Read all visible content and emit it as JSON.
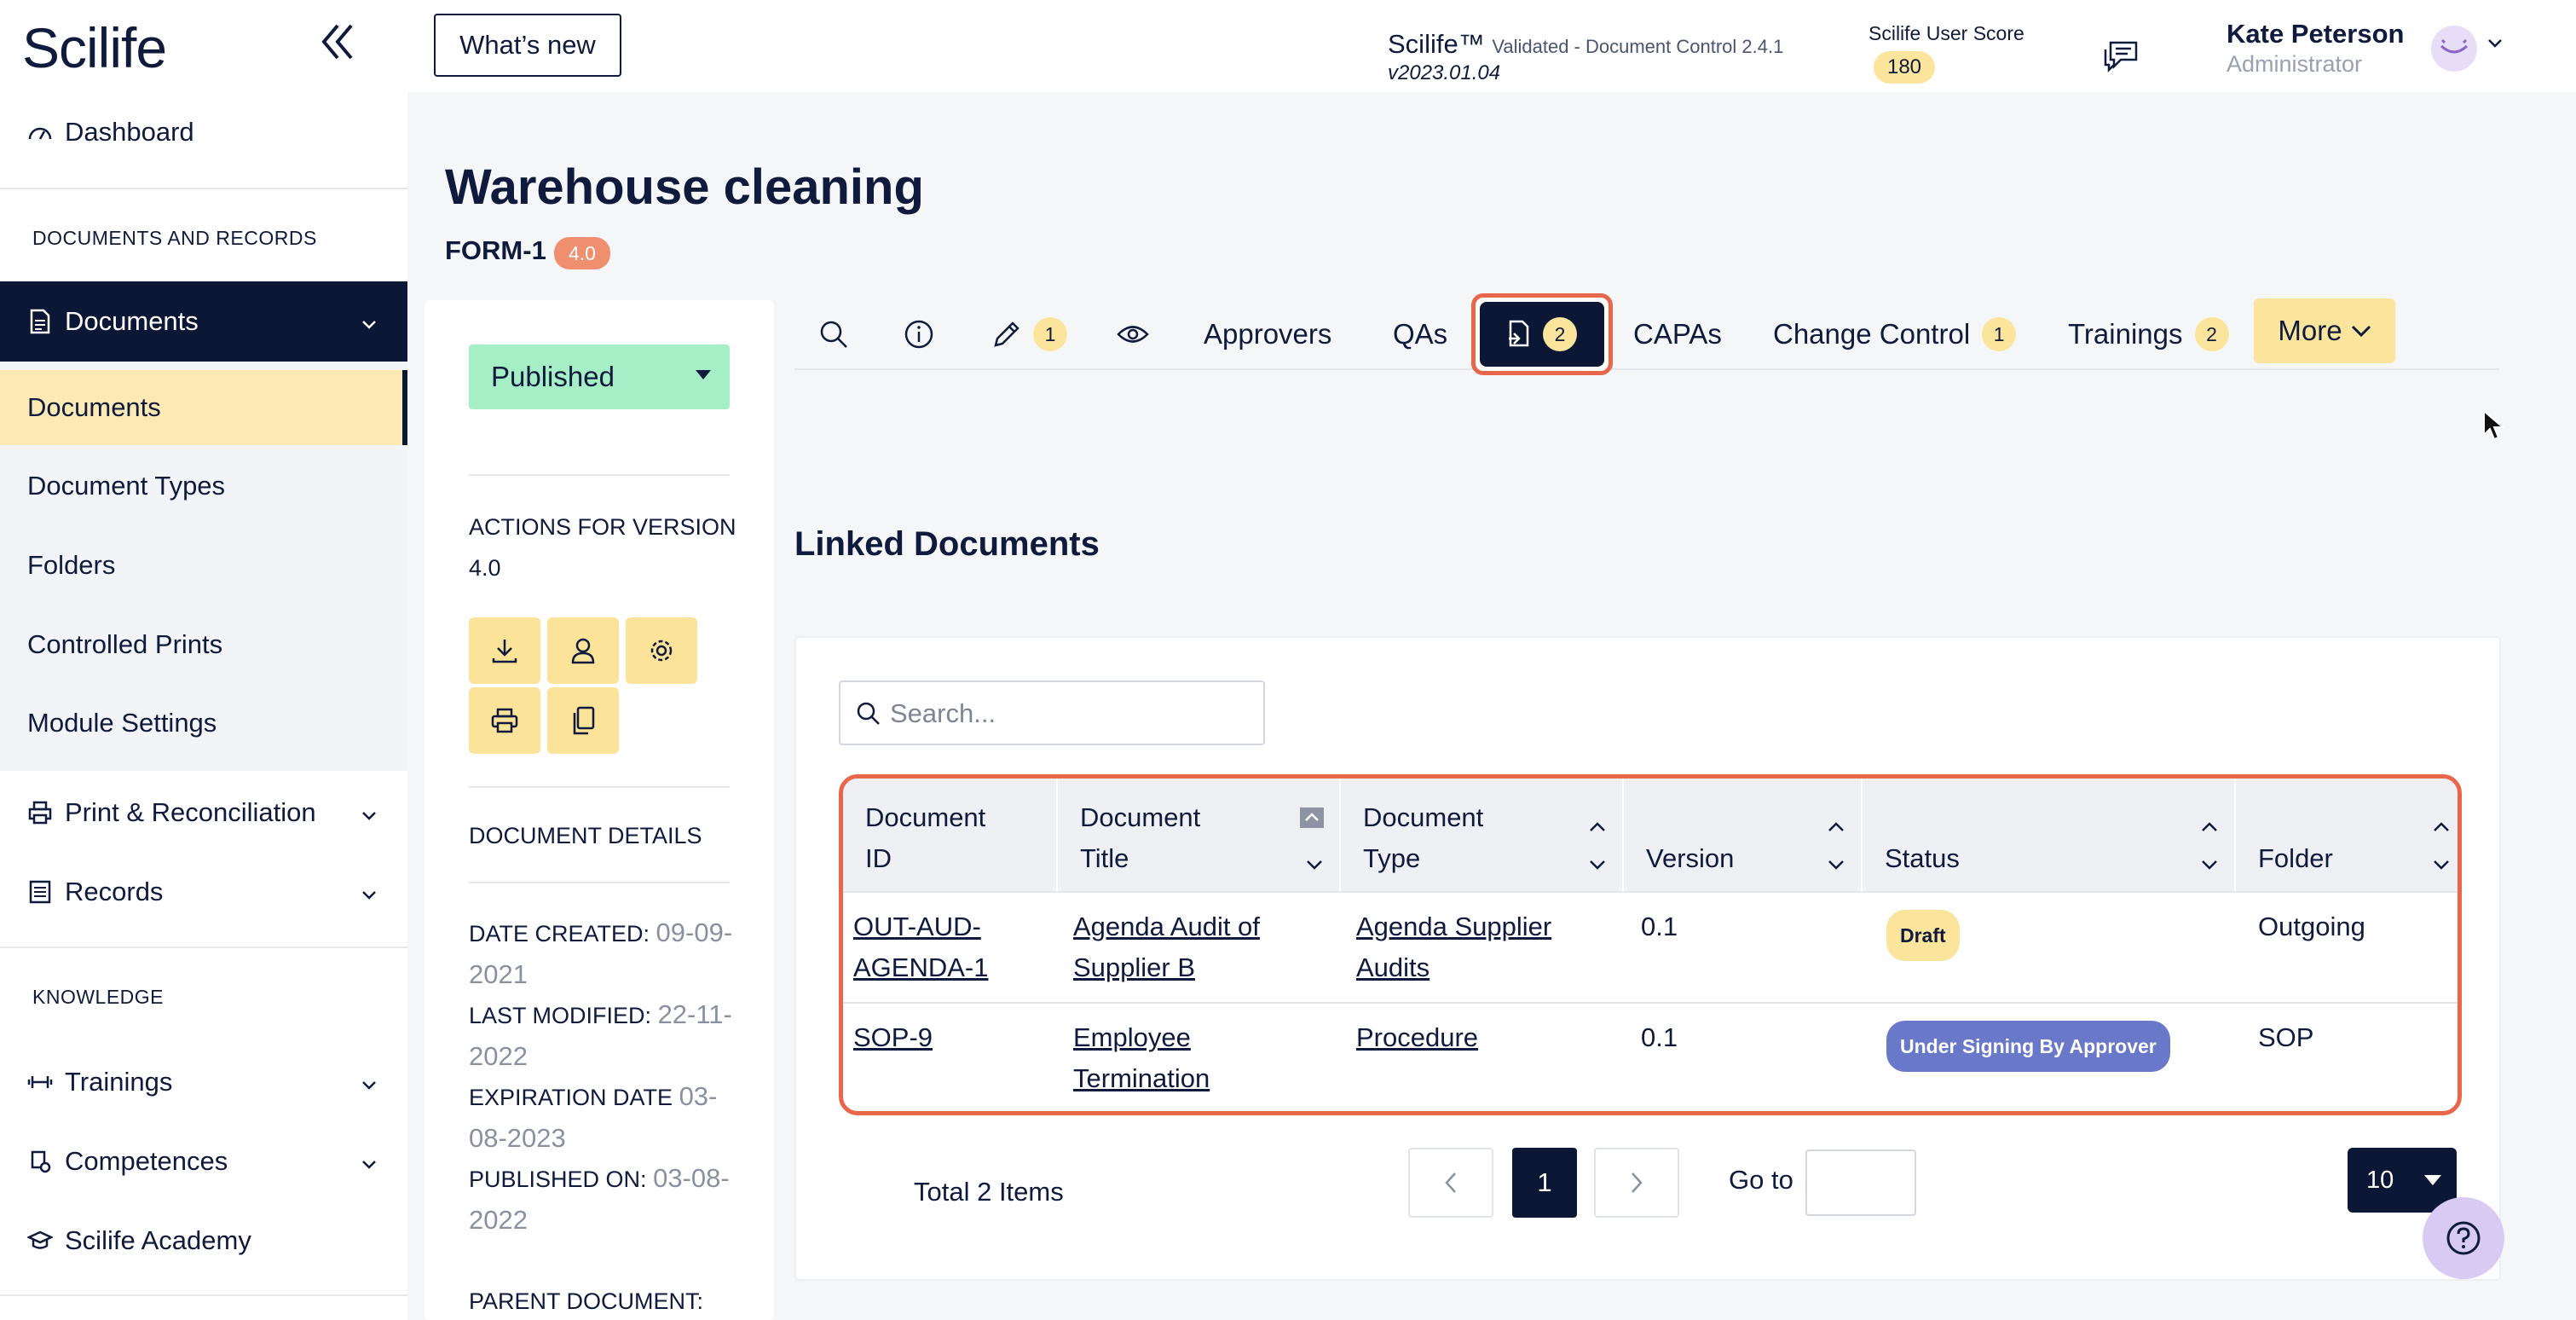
{
  "app": {
    "logo": "Scilife",
    "whats_new": "What’s new",
    "product_name": "Scilife™",
    "product_desc": "Validated - Document Control 2.4.1",
    "product_version": "v2023.01.04",
    "score_label": "Scilife User Score",
    "score_value": "180",
    "user_name": "Kate Peterson",
    "user_role": "Administrator"
  },
  "sidebar": {
    "dashboard": "Dashboard",
    "section_docs": "DOCUMENTS AND RECORDS",
    "documents": "Documents",
    "sub_items": [
      "Documents",
      "Document Types",
      "Folders",
      "Controlled Prints",
      "Module Settings"
    ],
    "print_recon": "Print & Reconciliation",
    "records": "Records",
    "section_knowledge": "KNOWLEDGE",
    "trainings": "Trainings",
    "competences": "Competences",
    "academy": "Scilife Academy"
  },
  "page": {
    "title": "Warehouse cleaning",
    "form_id": "FORM-1",
    "version": "4.0"
  },
  "left_panel": {
    "status": "Published",
    "actions_label": "ACTIONS FOR VERSION 4.0",
    "details_label": "DOCUMENT DETAILS",
    "date_created_label": "DATE CREATED:",
    "date_created": "09-09-2021",
    "last_modified_label": "LAST MODIFIED:",
    "last_modified": "22-11-2022",
    "expiration_label": "EXPIRATION DATE",
    "expiration": "03-08-2023",
    "published_label": "PUBLISHED ON:",
    "published": "03-08-2022",
    "parent_label": "PARENT DOCUMENT:"
  },
  "tabs": {
    "edit_badge": "1",
    "approvers": "Approvers",
    "qas": "QAs",
    "linked_badge": "2",
    "capas": "CAPAs",
    "change_control": "Change Control",
    "change_control_badge": "1",
    "trainings": "Trainings",
    "trainings_badge": "2",
    "more": "More"
  },
  "linked": {
    "title": "Linked Documents",
    "search_placeholder": "Search...",
    "headers": {
      "doc_id_1": "Document",
      "doc_id_2": "ID",
      "doc_title_1": "Document",
      "doc_title_2": "Title",
      "doc_type_1": "Document",
      "doc_type_2": "Type",
      "version": "Version",
      "status": "Status",
      "folder": "Folder"
    },
    "rows": [
      {
        "id_1": "OUT-AUD-",
        "id_2": "AGENDA-1",
        "title_1": "Agenda Audit of",
        "title_2": "Supplier B",
        "type_1": "Agenda Supplier",
        "type_2": "Audits",
        "version": "0.1",
        "status": "Draft",
        "folder": "Outgoing"
      },
      {
        "id_1": "SOP-9",
        "id_2": "",
        "title_1": "Employee",
        "title_2": "Termination",
        "type_1": "Procedure",
        "type_2": "",
        "version": "0.1",
        "status": "Under Signing By Approver",
        "folder": "SOP"
      }
    ],
    "total": "Total 2 Items",
    "current_page": "1",
    "goto_label": "Go to",
    "page_size": "10"
  },
  "colors": {
    "navy": "#0c1736",
    "highlight": "#e8664a",
    "yellow": "#fbe49b",
    "published": "#a6efc6"
  }
}
